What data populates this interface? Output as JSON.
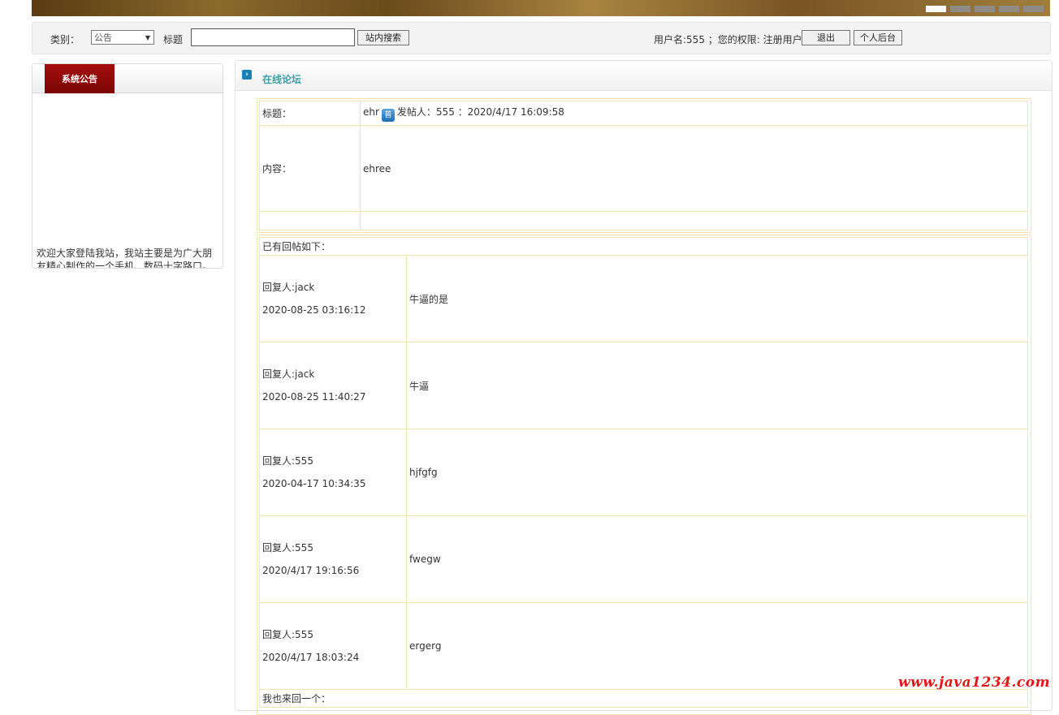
{
  "toolbar": {
    "category_label": "类别：",
    "category_value": "公告",
    "title_label": "标题",
    "search_value": "",
    "search_button": "站内搜索",
    "user_info": "用户名:555 ；您的权限: 注册用户",
    "logout_button": "退出",
    "personal_button": "个人后台"
  },
  "sidebar": {
    "tab_label": "系统公告",
    "notice_text": "欢迎大家登陆我站，我站主要是为广大朋友精心制作的一个手机、数码十字路口。"
  },
  "main": {
    "section_title": "在线论坛",
    "post": {
      "title_label": "标题：",
      "title_value": "ehr",
      "badge_icon": "book-icon",
      "badge_text": "普",
      "author_info": "发帖人：555 ：2020/4/17 16:09:58",
      "content_label": "内容：",
      "content_value": "ehree"
    },
    "replies_header": "已有回帖如下：",
    "replies": [
      {
        "author": "回复人:jack",
        "time": "2020-08-25 03:16:12",
        "content": "牛逼的是"
      },
      {
        "author": "回复人:jack",
        "time": "2020-08-25 11:40:27",
        "content": "牛逼"
      },
      {
        "author": "回复人:555",
        "time": "2020-04-17 10:34:35",
        "content": "hjfgfg"
      },
      {
        "author": "回复人:555",
        "time": "2020/4/17 19:16:56",
        "content": "fwegw"
      },
      {
        "author": "回复人:555",
        "time": "2020/4/17 18:03:24",
        "content": "ergerg"
      }
    ],
    "reply_prompt": "我也来回一个："
  },
  "watermark": "www.java1234.com",
  "colors": {
    "accent": "#3aa0a6",
    "tab": "#9a0a0a",
    "border": "#f0e4b0",
    "watermark": "#e01818"
  }
}
